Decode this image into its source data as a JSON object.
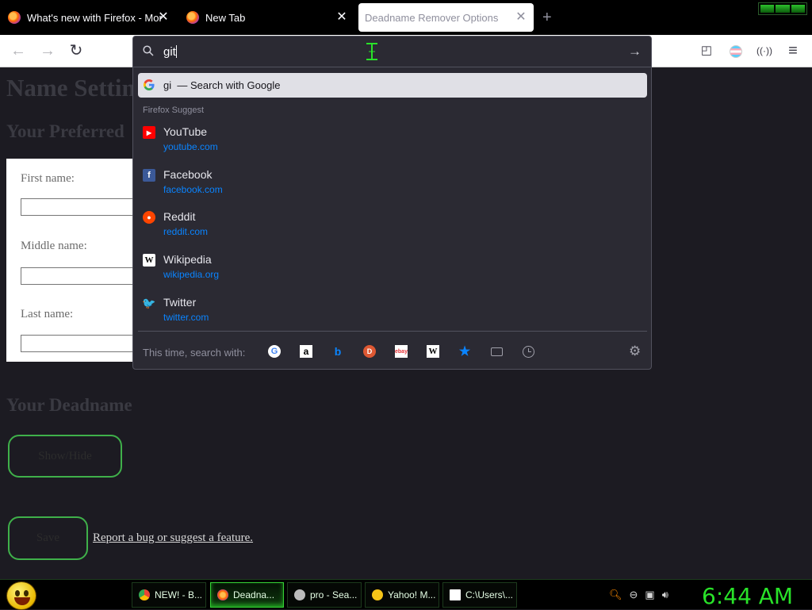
{
  "tabs": [
    {
      "title": "What's new with Firefox - More",
      "close": "✕"
    },
    {
      "title": "New Tab",
      "close": "✕"
    },
    {
      "title": "Deadname Remover Options",
      "close": "✕"
    }
  ],
  "new_tab": "+",
  "nav": {
    "back": "←",
    "forward": "→",
    "reload": "↻",
    "pocket": "◰",
    "ext2": "((·))",
    "menu": "≡"
  },
  "page": {
    "title": "Name Settings",
    "preferred_heading": "Your Preferred",
    "first_name_label": "First name:",
    "first_name_value": "",
    "middle_name_label": "Middle name:",
    "middle_name_value": "",
    "last_name_label": "Last name:",
    "last_name_value": "",
    "deadname_heading": "Your Deadname",
    "showhide_label": "Show/Hide",
    "save_label": "Save",
    "report_link": "Report a bug or suggest a feature."
  },
  "urlbar": {
    "typed": "git",
    "go": "→",
    "selected_suggestion": {
      "query": "gi",
      "separator": "—",
      "action": "Search with Google"
    },
    "suggest_header": "Firefox Suggest",
    "sites": [
      {
        "name": "YouTube",
        "url": "youtube.com",
        "icon": "youtube-icon",
        "color": "#ff0000"
      },
      {
        "name": "Facebook",
        "url": "facebook.com",
        "icon": "facebook-icon",
        "color": "#3b5998"
      },
      {
        "name": "Reddit",
        "url": "reddit.com",
        "icon": "reddit-icon",
        "color": "#ff4500"
      },
      {
        "name": "Wikipedia",
        "url": "wikipedia.org",
        "icon": "wikipedia-icon",
        "color": "#ffffff"
      },
      {
        "name": "Twitter",
        "url": "twitter.com",
        "icon": "twitter-icon",
        "color": "#1da1f2"
      }
    ],
    "oneoff_label": "This time, search with:",
    "engines": [
      "google-icon",
      "amazon-icon",
      "bing-icon",
      "duckduckgo-icon",
      "ebay-icon",
      "wikipedia-icon",
      "bookmarks-icon",
      "tabs-icon",
      "history-icon"
    ],
    "settings": "⚙"
  },
  "taskbar": {
    "items": [
      {
        "label": "NEW! - B...",
        "icon": "chrome-icon"
      },
      {
        "label": "Deadna...",
        "icon": "firefox-icon"
      },
      {
        "label": "pro - Sea...",
        "icon": "search-app-icon"
      },
      {
        "label": "Yahoo! M...",
        "icon": "yahoo-messenger-icon"
      },
      {
        "label": "C:\\Users\\...",
        "icon": "7zip-icon"
      }
    ],
    "clock": "6:44 AM"
  },
  "colors": {
    "accent_green": "#29e229",
    "link_blue": "#0a84ff",
    "popup_bg": "#2b2a33"
  }
}
